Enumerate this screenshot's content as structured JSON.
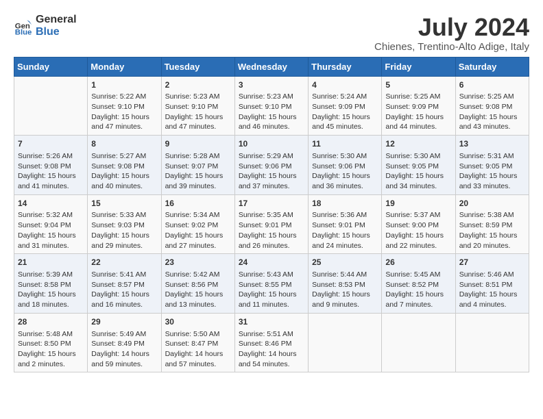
{
  "logo": {
    "line1": "General",
    "line2": "Blue"
  },
  "title": "July 2024",
  "subtitle": "Chienes, Trentino-Alto Adige, Italy",
  "days_of_week": [
    "Sunday",
    "Monday",
    "Tuesday",
    "Wednesday",
    "Thursday",
    "Friday",
    "Saturday"
  ],
  "weeks": [
    [
      {
        "day": "",
        "detail": ""
      },
      {
        "day": "1",
        "detail": "Sunrise: 5:22 AM\nSunset: 9:10 PM\nDaylight: 15 hours\nand 47 minutes."
      },
      {
        "day": "2",
        "detail": "Sunrise: 5:23 AM\nSunset: 9:10 PM\nDaylight: 15 hours\nand 47 minutes."
      },
      {
        "day": "3",
        "detail": "Sunrise: 5:23 AM\nSunset: 9:10 PM\nDaylight: 15 hours\nand 46 minutes."
      },
      {
        "day": "4",
        "detail": "Sunrise: 5:24 AM\nSunset: 9:09 PM\nDaylight: 15 hours\nand 45 minutes."
      },
      {
        "day": "5",
        "detail": "Sunrise: 5:25 AM\nSunset: 9:09 PM\nDaylight: 15 hours\nand 44 minutes."
      },
      {
        "day": "6",
        "detail": "Sunrise: 5:25 AM\nSunset: 9:08 PM\nDaylight: 15 hours\nand 43 minutes."
      }
    ],
    [
      {
        "day": "7",
        "detail": "Sunrise: 5:26 AM\nSunset: 9:08 PM\nDaylight: 15 hours\nand 41 minutes."
      },
      {
        "day": "8",
        "detail": "Sunrise: 5:27 AM\nSunset: 9:08 PM\nDaylight: 15 hours\nand 40 minutes."
      },
      {
        "day": "9",
        "detail": "Sunrise: 5:28 AM\nSunset: 9:07 PM\nDaylight: 15 hours\nand 39 minutes."
      },
      {
        "day": "10",
        "detail": "Sunrise: 5:29 AM\nSunset: 9:06 PM\nDaylight: 15 hours\nand 37 minutes."
      },
      {
        "day": "11",
        "detail": "Sunrise: 5:30 AM\nSunset: 9:06 PM\nDaylight: 15 hours\nand 36 minutes."
      },
      {
        "day": "12",
        "detail": "Sunrise: 5:30 AM\nSunset: 9:05 PM\nDaylight: 15 hours\nand 34 minutes."
      },
      {
        "day": "13",
        "detail": "Sunrise: 5:31 AM\nSunset: 9:05 PM\nDaylight: 15 hours\nand 33 minutes."
      }
    ],
    [
      {
        "day": "14",
        "detail": "Sunrise: 5:32 AM\nSunset: 9:04 PM\nDaylight: 15 hours\nand 31 minutes."
      },
      {
        "day": "15",
        "detail": "Sunrise: 5:33 AM\nSunset: 9:03 PM\nDaylight: 15 hours\nand 29 minutes."
      },
      {
        "day": "16",
        "detail": "Sunrise: 5:34 AM\nSunset: 9:02 PM\nDaylight: 15 hours\nand 27 minutes."
      },
      {
        "day": "17",
        "detail": "Sunrise: 5:35 AM\nSunset: 9:01 PM\nDaylight: 15 hours\nand 26 minutes."
      },
      {
        "day": "18",
        "detail": "Sunrise: 5:36 AM\nSunset: 9:01 PM\nDaylight: 15 hours\nand 24 minutes."
      },
      {
        "day": "19",
        "detail": "Sunrise: 5:37 AM\nSunset: 9:00 PM\nDaylight: 15 hours\nand 22 minutes."
      },
      {
        "day": "20",
        "detail": "Sunrise: 5:38 AM\nSunset: 8:59 PM\nDaylight: 15 hours\nand 20 minutes."
      }
    ],
    [
      {
        "day": "21",
        "detail": "Sunrise: 5:39 AM\nSunset: 8:58 PM\nDaylight: 15 hours\nand 18 minutes."
      },
      {
        "day": "22",
        "detail": "Sunrise: 5:41 AM\nSunset: 8:57 PM\nDaylight: 15 hours\nand 16 minutes."
      },
      {
        "day": "23",
        "detail": "Sunrise: 5:42 AM\nSunset: 8:56 PM\nDaylight: 15 hours\nand 13 minutes."
      },
      {
        "day": "24",
        "detail": "Sunrise: 5:43 AM\nSunset: 8:55 PM\nDaylight: 15 hours\nand 11 minutes."
      },
      {
        "day": "25",
        "detail": "Sunrise: 5:44 AM\nSunset: 8:53 PM\nDaylight: 15 hours\nand 9 minutes."
      },
      {
        "day": "26",
        "detail": "Sunrise: 5:45 AM\nSunset: 8:52 PM\nDaylight: 15 hours\nand 7 minutes."
      },
      {
        "day": "27",
        "detail": "Sunrise: 5:46 AM\nSunset: 8:51 PM\nDaylight: 15 hours\nand 4 minutes."
      }
    ],
    [
      {
        "day": "28",
        "detail": "Sunrise: 5:48 AM\nSunset: 8:50 PM\nDaylight: 15 hours\nand 2 minutes."
      },
      {
        "day": "29",
        "detail": "Sunrise: 5:49 AM\nSunset: 8:49 PM\nDaylight: 14 hours\nand 59 minutes."
      },
      {
        "day": "30",
        "detail": "Sunrise: 5:50 AM\nSunset: 8:47 PM\nDaylight: 14 hours\nand 57 minutes."
      },
      {
        "day": "31",
        "detail": "Sunrise: 5:51 AM\nSunset: 8:46 PM\nDaylight: 14 hours\nand 54 minutes."
      },
      {
        "day": "",
        "detail": ""
      },
      {
        "day": "",
        "detail": ""
      },
      {
        "day": "",
        "detail": ""
      }
    ]
  ]
}
